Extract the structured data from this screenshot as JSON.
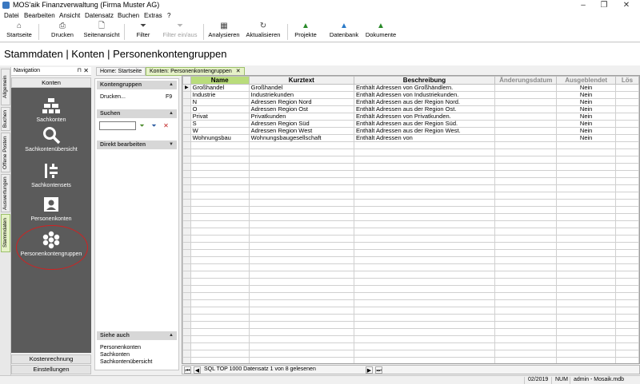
{
  "window": {
    "title": "MOS'aik Finanzverwaltung (Firma Muster AG)",
    "controls": [
      "–",
      "❐",
      "✕"
    ]
  },
  "menu": [
    "Datei",
    "Bearbeiten",
    "Ansicht",
    "Datensatz",
    "Buchen",
    "Extras",
    "?"
  ],
  "toolbar": [
    {
      "label": "Startseite",
      "icon": "home-icon",
      "enabled": true
    },
    {
      "label": "Drucken",
      "icon": "print-icon",
      "enabled": true
    },
    {
      "label": "Seitenansicht",
      "icon": "page-preview-icon",
      "enabled": true
    },
    {
      "label": "Filter",
      "icon": "filter-icon",
      "enabled": true
    },
    {
      "label": "Filter ein/aus",
      "icon": "filter-toggle-icon",
      "enabled": false
    },
    {
      "label": "Analysieren",
      "icon": "analyze-icon",
      "enabled": true
    },
    {
      "label": "Aktualisieren",
      "icon": "refresh-icon",
      "enabled": true
    },
    {
      "label": "Projekte",
      "icon": "projects-icon",
      "enabled": true
    },
    {
      "label": "Datenbank",
      "icon": "database-icon",
      "enabled": true
    },
    {
      "label": "Dokumente",
      "icon": "documents-icon",
      "enabled": true
    }
  ],
  "header": {
    "title": "Stammdaten | Konten | Personenkontengruppen"
  },
  "vtabs": [
    "Allgemein",
    "Buchen",
    "Offene Posten",
    "Auswertungen",
    "Stammdaten"
  ],
  "navigation": {
    "title": "Navigation",
    "pin": "⊓",
    "close": "✕",
    "group": "Konten",
    "items": [
      {
        "label": "Sachkonten",
        "icon": "bricks-icon"
      },
      {
        "label": "Sachkontenübersicht",
        "icon": "magnifier-icon"
      },
      {
        "label": "Sachkontensets",
        "icon": "sets-icon"
      },
      {
        "label": "Personenkonten",
        "icon": "person-card-icon"
      },
      {
        "label": "Personenkontengruppen",
        "icon": "group-icon"
      }
    ],
    "bottom": [
      "Kostenrechnung",
      "Einstellungen"
    ]
  },
  "sidepanel": {
    "kontengruppen": {
      "title": "Kontengruppen",
      "item": "Drucken...",
      "shortcut": "F9"
    },
    "suchen": {
      "title": "Suchen",
      "value": ""
    },
    "direkt": {
      "title": "Direkt bearbeiten"
    },
    "siehe": {
      "title": "Siehe auch",
      "items": [
        "Personenkonten",
        "Sachkonten",
        "Sachkontenübersicht"
      ]
    }
  },
  "tabs": {
    "home": "Home: Startseite",
    "active": "Konten: Personenkontengruppen",
    "close": "✕"
  },
  "table": {
    "columns": [
      "Name",
      "Kurztext",
      "Beschreibung",
      "Änderungsdatum",
      "Ausgeblendet",
      "Lös"
    ],
    "rows": [
      [
        "Großhandel",
        "Großhandel",
        "Enthält Adressen von Großhändlern.",
        "",
        "Nein"
      ],
      [
        "Industrie",
        "Industriekunden",
        "Enthält Adressen von Industriekunden.",
        "",
        "Nein"
      ],
      [
        "N",
        "Adressen Region Nord",
        "Enthält Adressen aus der Region Nord.",
        "",
        "Nein"
      ],
      [
        "O",
        "Adressen Region Ost",
        "Enthält Adressen aus der Region Ost.",
        "",
        "Nein"
      ],
      [
        "Privat",
        "Privatkunden",
        "Enthält Adressen von Privatkunden.",
        "",
        "Nein"
      ],
      [
        "S",
        "Adressen Region Süd",
        "Enthält Adressen aus der Region Süd.",
        "",
        "Nein"
      ],
      [
        "W",
        "Adressen Region West",
        "Enthält Adressen aus der Region West.",
        "",
        "Nein"
      ],
      [
        "Wohnungsbau",
        "Wohnungsbaugesellschaft",
        "Enthält Adressen von",
        "",
        "Nein"
      ]
    ]
  },
  "recordnav": {
    "text": "SQL TOP 1000 Datensatz 1 von 8 gelesenen"
  },
  "statusbar": {
    "period": "02/2019",
    "num": "NUM",
    "user": "admin - Mosaik.mdb"
  }
}
